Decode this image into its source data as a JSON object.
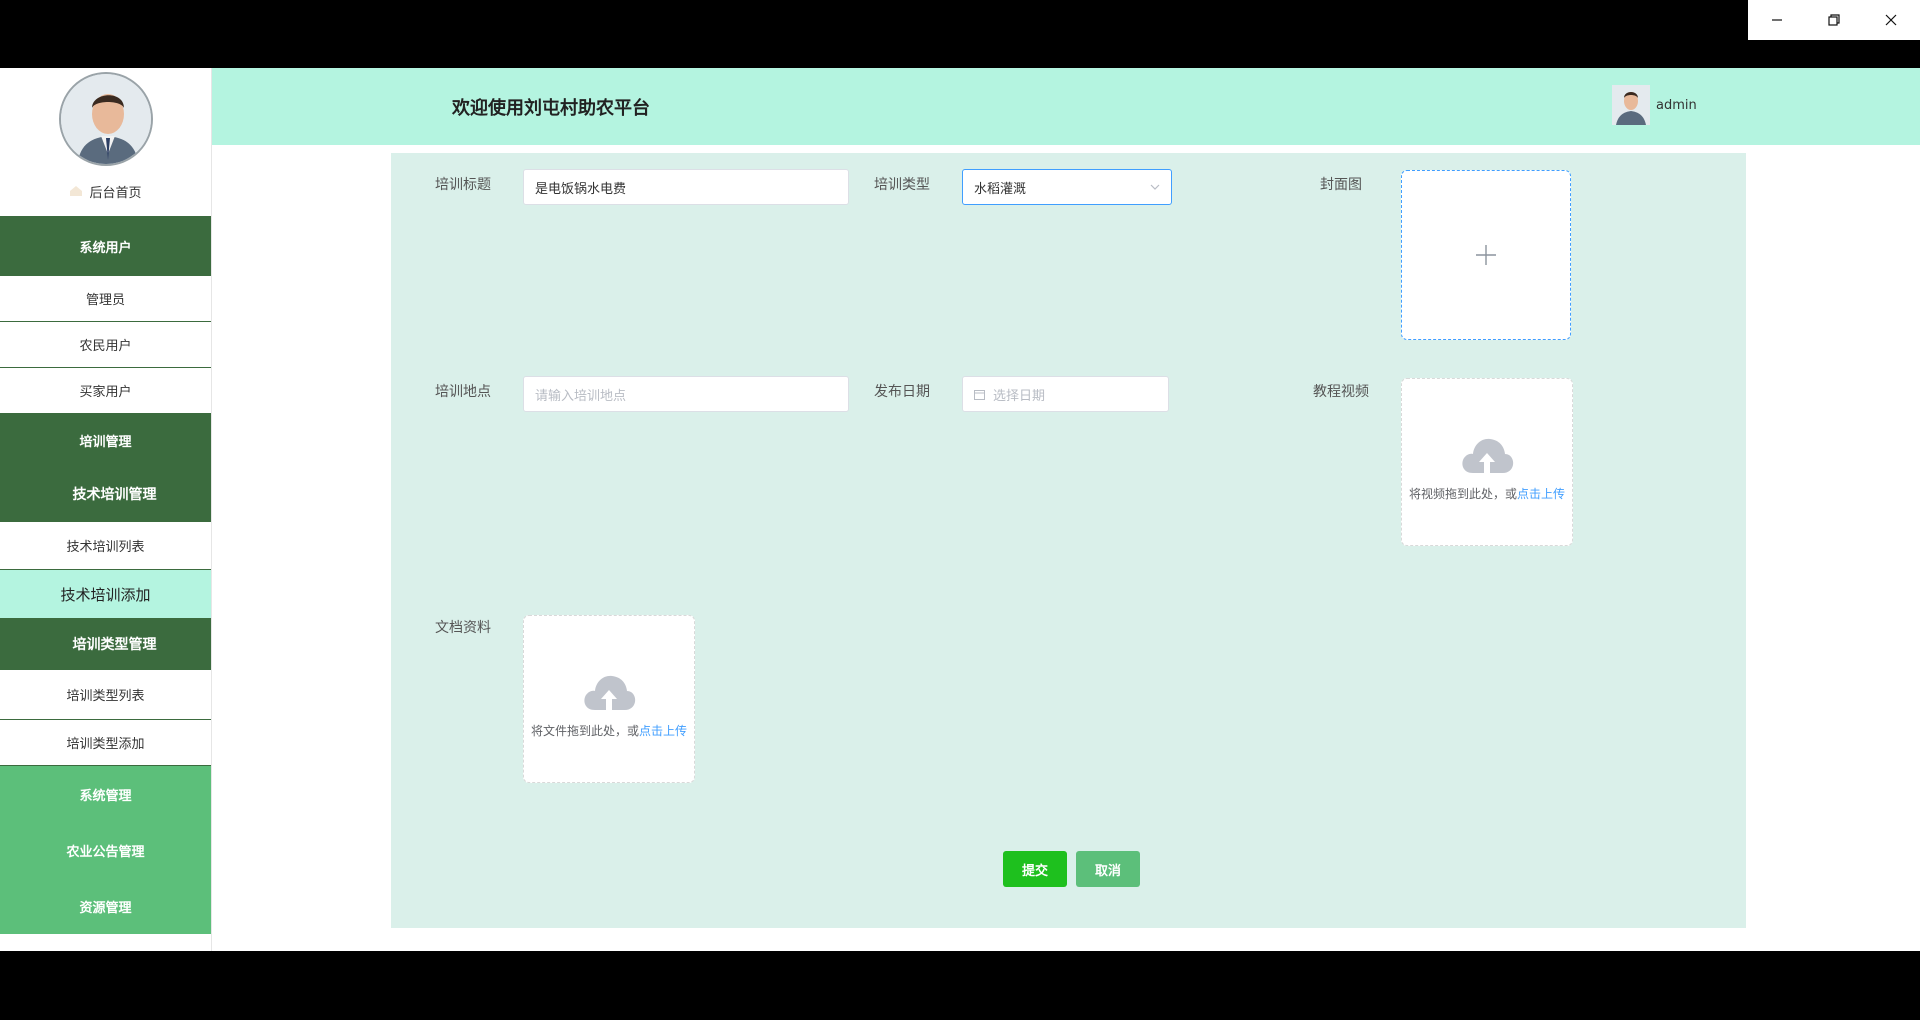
{
  "window": {
    "minimize_icon": "minimize-icon",
    "restore_icon": "restore-icon",
    "close_icon": "close-icon"
  },
  "header": {
    "title": "欢迎使用刘屯村助农平台",
    "username": "admin"
  },
  "sidebar": {
    "home_label": "后台首页",
    "group_system_users": "系统用户",
    "items_users": [
      "管理员",
      "农民用户",
      "买家用户"
    ],
    "group_training": "培训管理",
    "submenu_tech_training": "技术培训管理",
    "tech_list": "技术培训列表",
    "tech_add": "技术培训添加",
    "submenu_type": "培训类型管理",
    "type_list": "培训类型列表",
    "type_add": "培训类型添加",
    "group_system_manage": "系统管理",
    "group_notice": "农业公告管理",
    "group_resource": "资源管理"
  },
  "form": {
    "title_label": "培训标题",
    "title_value": "是电饭锅水电费",
    "type_label": "培训类型",
    "type_value": "水稻灌溉",
    "cover_label": "封面图",
    "location_label": "培训地点",
    "location_placeholder": "请输入培训地点",
    "date_label": "发布日期",
    "date_placeholder": "选择日期",
    "video_label": "教程视频",
    "video_drag_text": "将视频拖到此处，或",
    "video_link": "点击上传",
    "doc_label": "文档资料",
    "doc_drag_text": "将文件拖到此处，或",
    "doc_link": "点击上传",
    "submit": "提交",
    "cancel": "取消"
  },
  "colors": {
    "accent_dark_green": "#3b6b3e",
    "accent_light_green": "#5cbf7a",
    "header_mint": "#b4f4e0",
    "content_bg": "#daf0ea",
    "submit_green": "#1ec01e",
    "link_blue": "#409eff"
  }
}
